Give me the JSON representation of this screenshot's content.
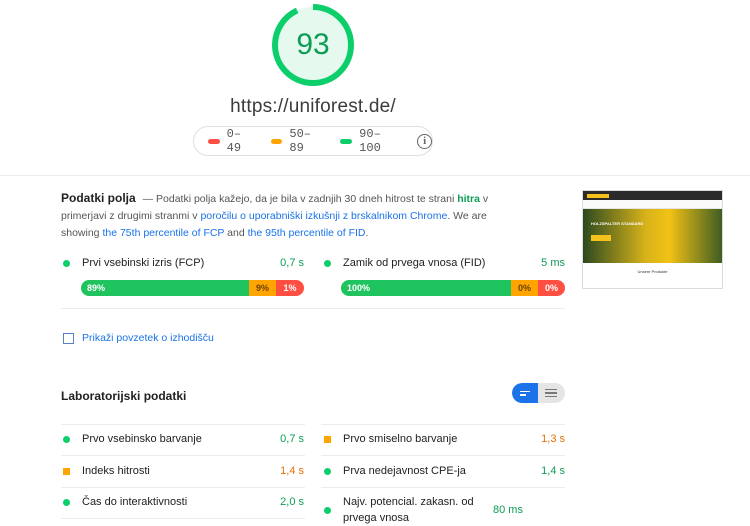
{
  "score": {
    "value": "93",
    "fraction": 0.93,
    "color": "#0cce6b"
  },
  "url": "https://uniforest.de/",
  "legend": [
    {
      "label": "0–49",
      "color": "#ff4e42"
    },
    {
      "label": "50–89",
      "color": "#ffa400"
    },
    {
      "label": "90–100",
      "color": "#0cce6b"
    }
  ],
  "field": {
    "title": "Podatki polja",
    "intro_1": " — Podatki polja kažejo, da je bila v zadnjih 30 dneh hitrost te strani ",
    "speed_word": "hitra",
    "intro_2": " v primerjavi z drugimi stranmi v ",
    "crux_link": "poročilu o uporabniški izkušnji z brskalnikom Chrome",
    "intro_3": ". We are showing ",
    "p75": "the 75th percentile of FCP",
    "intro_4": " and ",
    "p95": "the 95th percentile of FID",
    "intro_5": ".",
    "metrics": [
      {
        "name": "Prvi vsebinski izris (FCP)",
        "value": "0,7 s",
        "dist": {
          "good": "89%",
          "avg": "9%",
          "poor": "1%"
        }
      },
      {
        "name": "Zamik od prvega vnosa (FID)",
        "value": "5 ms",
        "dist": {
          "good": "100%",
          "avg": "0%",
          "poor": "0%"
        }
      }
    ],
    "origin_toggle": "Prikaži povzetek o izhodišču"
  },
  "thumbnail": {
    "hero_text": "HOLZSPALTER STANDARD",
    "sub_text": "Unsere Produkte"
  },
  "lab": {
    "title": "Laboratorijski podatki",
    "metrics": [
      {
        "name": "Prvo vsebinsko barvanje",
        "value": "0,7 s",
        "status": "good"
      },
      {
        "name": "Prvo smiselno barvanje",
        "value": "1,3 s",
        "status": "average"
      },
      {
        "name": "Indeks hitrosti",
        "value": "1,4 s",
        "status": "average"
      },
      {
        "name": "Prva nedejavnost CPE-ja",
        "value": "1,4 s",
        "status": "good"
      },
      {
        "name": "Čas do interaktivnosti",
        "value": "2,0 s",
        "status": "good"
      },
      {
        "name": "Najv. potencial. zakasn. od prvega vnosa",
        "value": "80 ms",
        "status": "good"
      }
    ]
  },
  "colors": {
    "good_text": "#0c9d55",
    "avg_text": "#e8710a",
    "good_dot": "#0cce6b",
    "avg_dot": "#ffa400",
    "link": "#1a73e8"
  }
}
